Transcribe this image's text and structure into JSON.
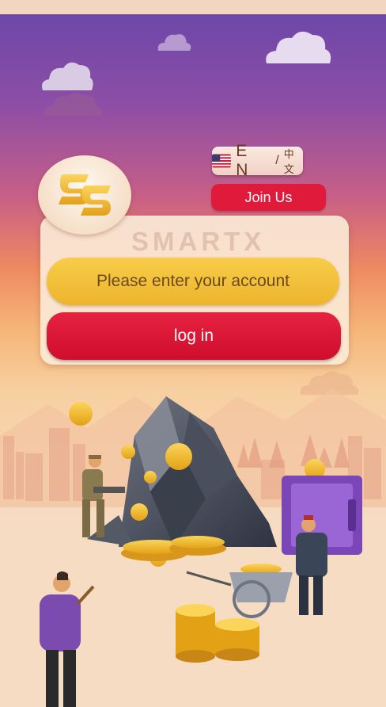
{
  "header": {
    "language": {
      "en": "E N",
      "separator": "/",
      "zh": "中文",
      "flag_icon": "us-flag-icon"
    },
    "join_label": "Join Us"
  },
  "brand": {
    "name": "SMARTX",
    "logo_icon": "ss-logo-icon"
  },
  "login": {
    "account_placeholder": "Please enter your account",
    "account_value": "",
    "login_label": "log in"
  },
  "colors": {
    "join": "#e01a3a",
    "login": "#d81334",
    "input": "#f2c13c",
    "sky_top": "#6d47a8",
    "sky_mid": "#ee8a62"
  },
  "illustration": {
    "items": [
      "miner-with-drill",
      "rock-pile",
      "gold-coins",
      "purple-safe",
      "businessman",
      "wheelbarrow",
      "man-with-bat"
    ]
  }
}
